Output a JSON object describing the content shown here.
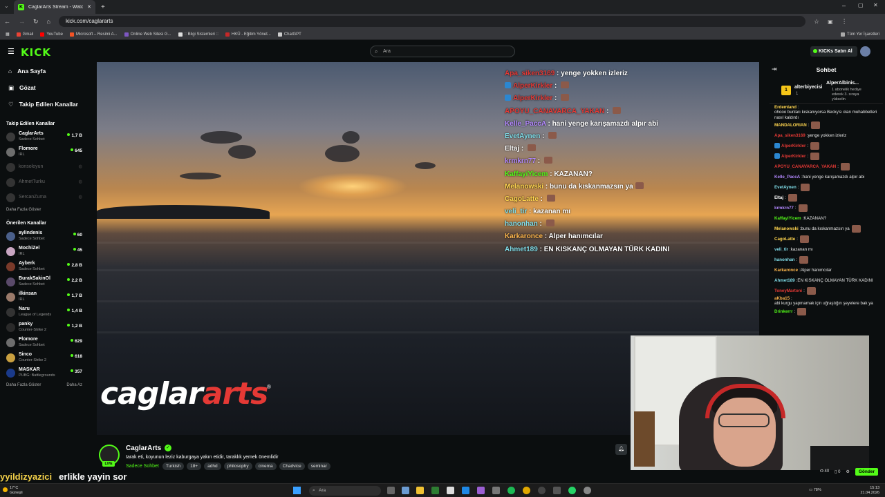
{
  "browser": {
    "tab_title": "CaglarArts Stream - Watch",
    "url": "kick.com/caglararts",
    "bookmarks": [
      "Gmail",
      "YouTube",
      "Microsoft – Resimi A...",
      "Online Web Sitesi G...",
      ":: Bilgi Sistemleri ::",
      "HKÜ - Eğitim Yönet...",
      "ChatGPT"
    ],
    "all_bookmarks": "Tüm Yer İşaretleri"
  },
  "topnav": {
    "logo": "KICK",
    "search_placeholder": "Ara",
    "buy_ai": "KICKs Satın Al"
  },
  "sidebar": {
    "nav": [
      {
        "label": "Ana Sayfa",
        "icon": "home-icon"
      },
      {
        "label": "Gözat",
        "icon": "compass-icon"
      },
      {
        "label": "Takip Edilen Kanallar",
        "icon": "heart-icon"
      }
    ],
    "followed_header": "Takip Edilen Kanallar",
    "followed": [
      {
        "name": "CaglarArts",
        "sub": "Sadece Sohbet",
        "viewers": "1,7 B",
        "live": true
      },
      {
        "name": "Flomore",
        "sub": "IRL",
        "viewers": "645",
        "live": true
      },
      {
        "name": "konsoloyun",
        "sub": "",
        "viewers": "",
        "live": false
      },
      {
        "name": "AhmetTurku",
        "sub": "",
        "viewers": "",
        "live": false
      },
      {
        "name": "SercanZuma",
        "sub": "",
        "viewers": "",
        "live": false
      }
    ],
    "show_more_1": "Daha Fazla Göster",
    "recommended_header": "Önerilen Kanallar",
    "recommended": [
      {
        "name": "aylindenis",
        "sub": "Sadece Sohbet",
        "viewers": "60"
      },
      {
        "name": "MochiZel",
        "sub": "IRL",
        "viewers": "45"
      },
      {
        "name": "Ayberk",
        "sub": "Sadece Sohbet",
        "viewers": "2,8 B"
      },
      {
        "name": "BurakSakinOl",
        "sub": "Sadece Sohbet",
        "viewers": "2,2 B"
      },
      {
        "name": "ilkinsan",
        "sub": "IRL",
        "viewers": "1,7 B"
      },
      {
        "name": "Naru",
        "sub": "League of Legends",
        "viewers": "1,4 B"
      },
      {
        "name": "panky",
        "sub": "Counter-Strike 2",
        "viewers": "1,2 B"
      },
      {
        "name": "Flomore",
        "sub": "Sadece Sohbet",
        "viewers": "629"
      },
      {
        "name": "Sinco",
        "sub": "Counter-Strike 2",
        "viewers": "618"
      },
      {
        "name": "MASKAR",
        "sub": "PUBG: Battlegrounds",
        "viewers": "357"
      }
    ],
    "show_more_2": "Daha Fazla Göster",
    "show_less": "Daha Az"
  },
  "video": {
    "brand_main": "caglar",
    "brand_accent": "arts",
    "reg": "®",
    "overlay_chat": [
      {
        "user": "Apa_siken3169",
        "color": "#e53935",
        "msg": "yenge yokken izleriz",
        "emote": false,
        "badge": false
      },
      {
        "user": "AlperKirkler",
        "color": "#e53935",
        "msg": "",
        "emote": true,
        "badge": true
      },
      {
        "user": "AlperKirkler",
        "color": "#e53935",
        "msg": "",
        "emote": true,
        "badge": true
      },
      {
        "user": "APOYU_CANAVARCA_YAKAN",
        "color": "#e53935",
        "msg": "",
        "emote": true,
        "badge": false
      },
      {
        "user": "Kelle_PaccA",
        "color": "#b388ff",
        "msg": "hani yenge karışamazdı alpır abi",
        "emote": false,
        "badge": false
      },
      {
        "user": "EvetAynen",
        "color": "#80deea",
        "msg": "",
        "emote": true,
        "badge": false
      },
      {
        "user": "Eltaj",
        "color": "#ffffff",
        "msg": "",
        "emote": true,
        "badge": false
      },
      {
        "user": "krmkrn77",
        "color": "#b388ff",
        "msg": "",
        "emote": true,
        "badge": false
      },
      {
        "user": "KaffayiYicem",
        "color": "#53fc18",
        "msg": "KAZANAN?",
        "emote": false,
        "badge": false
      },
      {
        "user": "Melanowski",
        "color": "#ffd54f",
        "msg": "bunu da kıskanmazsın ya",
        "emote": true,
        "badge": false
      },
      {
        "user": "CagoLatte",
        "color": "#ffd54f",
        "msg": "",
        "emote": true,
        "badge": false
      },
      {
        "user": "veli_tir",
        "color": "#80deea",
        "msg": "kazanan mı",
        "emote": false,
        "badge": false
      },
      {
        "user": "hanonhan",
        "color": "#80deea",
        "msg": "",
        "emote": true,
        "badge": false
      },
      {
        "user": "Karkaronce",
        "color": "#ffb74d",
        "msg": "Alper hanımcılar",
        "emote": false,
        "badge": false
      },
      {
        "user": "Ahmet189",
        "color": "#80deea",
        "msg": "EN KISKANÇ OLMAYAN TÜRK KADINI",
        "emote": false,
        "badge": false
      }
    ]
  },
  "stream_info": {
    "channel": "CaglarArts",
    "live": "LIVE",
    "title": "tarak eti, koyunun leziz kaburgaya yakın etidir, taraklık yemek önemlidir",
    "category": "Sadece Sohbet",
    "tags": [
      "Turkish",
      "18+",
      "adhd",
      "philosophy",
      "cinema",
      "Chadvice",
      "seminar"
    ]
  },
  "chat": {
    "header": "Sohbet",
    "pinned_user": "alterbiyecisi",
    "pinned_count": "1",
    "pinned_gift_user": "AlperAlbinis...",
    "pinned_gift_msg": "1 abonelik hediye ederek 3. sıraya yükselin",
    "messages": [
      {
        "user": "Erdemland",
        "color": "#ffd54f",
        "msg": "ohooo bunları kıskanıyorsa Becky'e olan muhabbetleri nasıl kaldırdı",
        "emote": false,
        "badge": false
      },
      {
        "user": "MANDALORIAN",
        "color": "#ffd54f",
        "msg": "",
        "emote": true,
        "badge": false
      },
      {
        "user": "Apa_siken3169",
        "color": "#e53935",
        "msg": "yenge yokken izleriz",
        "emote": false,
        "badge": false
      },
      {
        "user": "AlperKirkler",
        "color": "#e53935",
        "msg": "",
        "emote": true,
        "badge": true
      },
      {
        "user": "AlperKirkler",
        "color": "#e53935",
        "msg": "",
        "emote": true,
        "badge": true
      },
      {
        "user": "APOYU_CANAVARCA_YAKAN",
        "color": "#e53935",
        "msg": "",
        "emote": true,
        "badge": false
      },
      {
        "user": "Kelle_PaccA",
        "color": "#b388ff",
        "msg": "hani yenge karışamazdı alpır abi",
        "emote": false,
        "badge": false
      },
      {
        "user": "EvetAynen",
        "color": "#80deea",
        "msg": "",
        "emote": true,
        "badge": false
      },
      {
        "user": "Eltaj",
        "color": "#ffffff",
        "msg": "",
        "emote": true,
        "badge": false
      },
      {
        "user": "krmkrn77",
        "color": "#b388ff",
        "msg": "",
        "emote": true,
        "badge": false
      },
      {
        "user": "KaffayiYicem",
        "color": "#53fc18",
        "msg": "KAZANAN?",
        "emote": false,
        "badge": false
      },
      {
        "user": "Melanowski",
        "color": "#ffd54f",
        "msg": "bunu da kıskanmazsın ya",
        "emote": true,
        "badge": false
      },
      {
        "user": "CagoLatte",
        "color": "#ffd54f",
        "msg": "",
        "emote": true,
        "badge": false
      },
      {
        "user": "veli_tir",
        "color": "#80deea",
        "msg": "kazanan mı",
        "emote": false,
        "badge": false
      },
      {
        "user": "hanonhan",
        "color": "#80deea",
        "msg": "",
        "emote": true,
        "badge": false
      },
      {
        "user": "Karkaronce",
        "color": "#ffb74d",
        "msg": "Alper hanımcılar",
        "emote": false,
        "badge": false
      },
      {
        "user": "Ahmet189",
        "color": "#80deea",
        "msg": "EN KISKANÇ OLMAYAN TÜRK KADINI",
        "emote": false,
        "badge": false
      },
      {
        "user": "ToneyMartoni",
        "color": "#e53935",
        "msg": "",
        "emote": true,
        "badge": false
      },
      {
        "user": "aKba15",
        "color": "#ffb74d",
        "msg": "abi kurgu yapmamak için uğraştığın şeyelere bak ya",
        "emote": false,
        "badge": false
      },
      {
        "user": "Drinkerrr",
        "color": "#53fc18",
        "msg": "",
        "emote": true,
        "badge": false
      }
    ],
    "count_a": "40",
    "count_b": "0",
    "send": "Gönder"
  },
  "bottom_overlay": {
    "user": "yyildizyazici",
    "msg": "erlikle yayin sor"
  },
  "taskbar": {
    "temp": "17°C",
    "weather": "Güneşli",
    "search": "Ara",
    "battery": "78%",
    "time": "15:13",
    "date": "21.04.2026"
  },
  "colors": {
    "brand": "#53fc18",
    "bg": "#0b0e0f"
  }
}
